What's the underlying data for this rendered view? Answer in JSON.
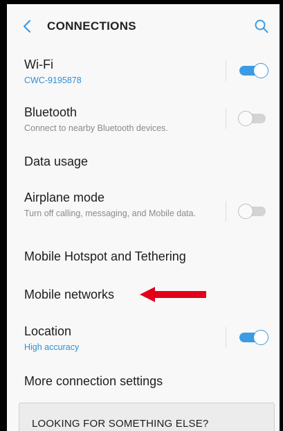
{
  "header": {
    "title": "CONNECTIONS",
    "back_icon": "chevron-left-icon",
    "search_icon": "search-icon"
  },
  "rows": {
    "wifi": {
      "title": "Wi-Fi",
      "subtitle": "CWC-9195878",
      "toggle_on": true
    },
    "bluetooth": {
      "title": "Bluetooth",
      "subtitle": "Connect to nearby Bluetooth devices.",
      "toggle_on": false
    },
    "data_usage": {
      "title": "Data usage"
    },
    "airplane": {
      "title": "Airplane mode",
      "subtitle": "Turn off calling, messaging, and Mobile data.",
      "toggle_on": false
    },
    "hotspot": {
      "title": "Mobile Hotspot and Tethering"
    },
    "mobile_networks": {
      "title": "Mobile networks"
    },
    "location": {
      "title": "Location",
      "subtitle": "High accuracy",
      "toggle_on": true
    },
    "more_settings": {
      "title": "More connection settings"
    }
  },
  "looking_card": {
    "label": "LOOKING FOR SOMETHING ELSE?"
  },
  "colors": {
    "accent": "#3b9be3",
    "subtitle_link": "#2d8fd5",
    "annotation_arrow": "#e3001b",
    "background": "#f8f8f8"
  }
}
